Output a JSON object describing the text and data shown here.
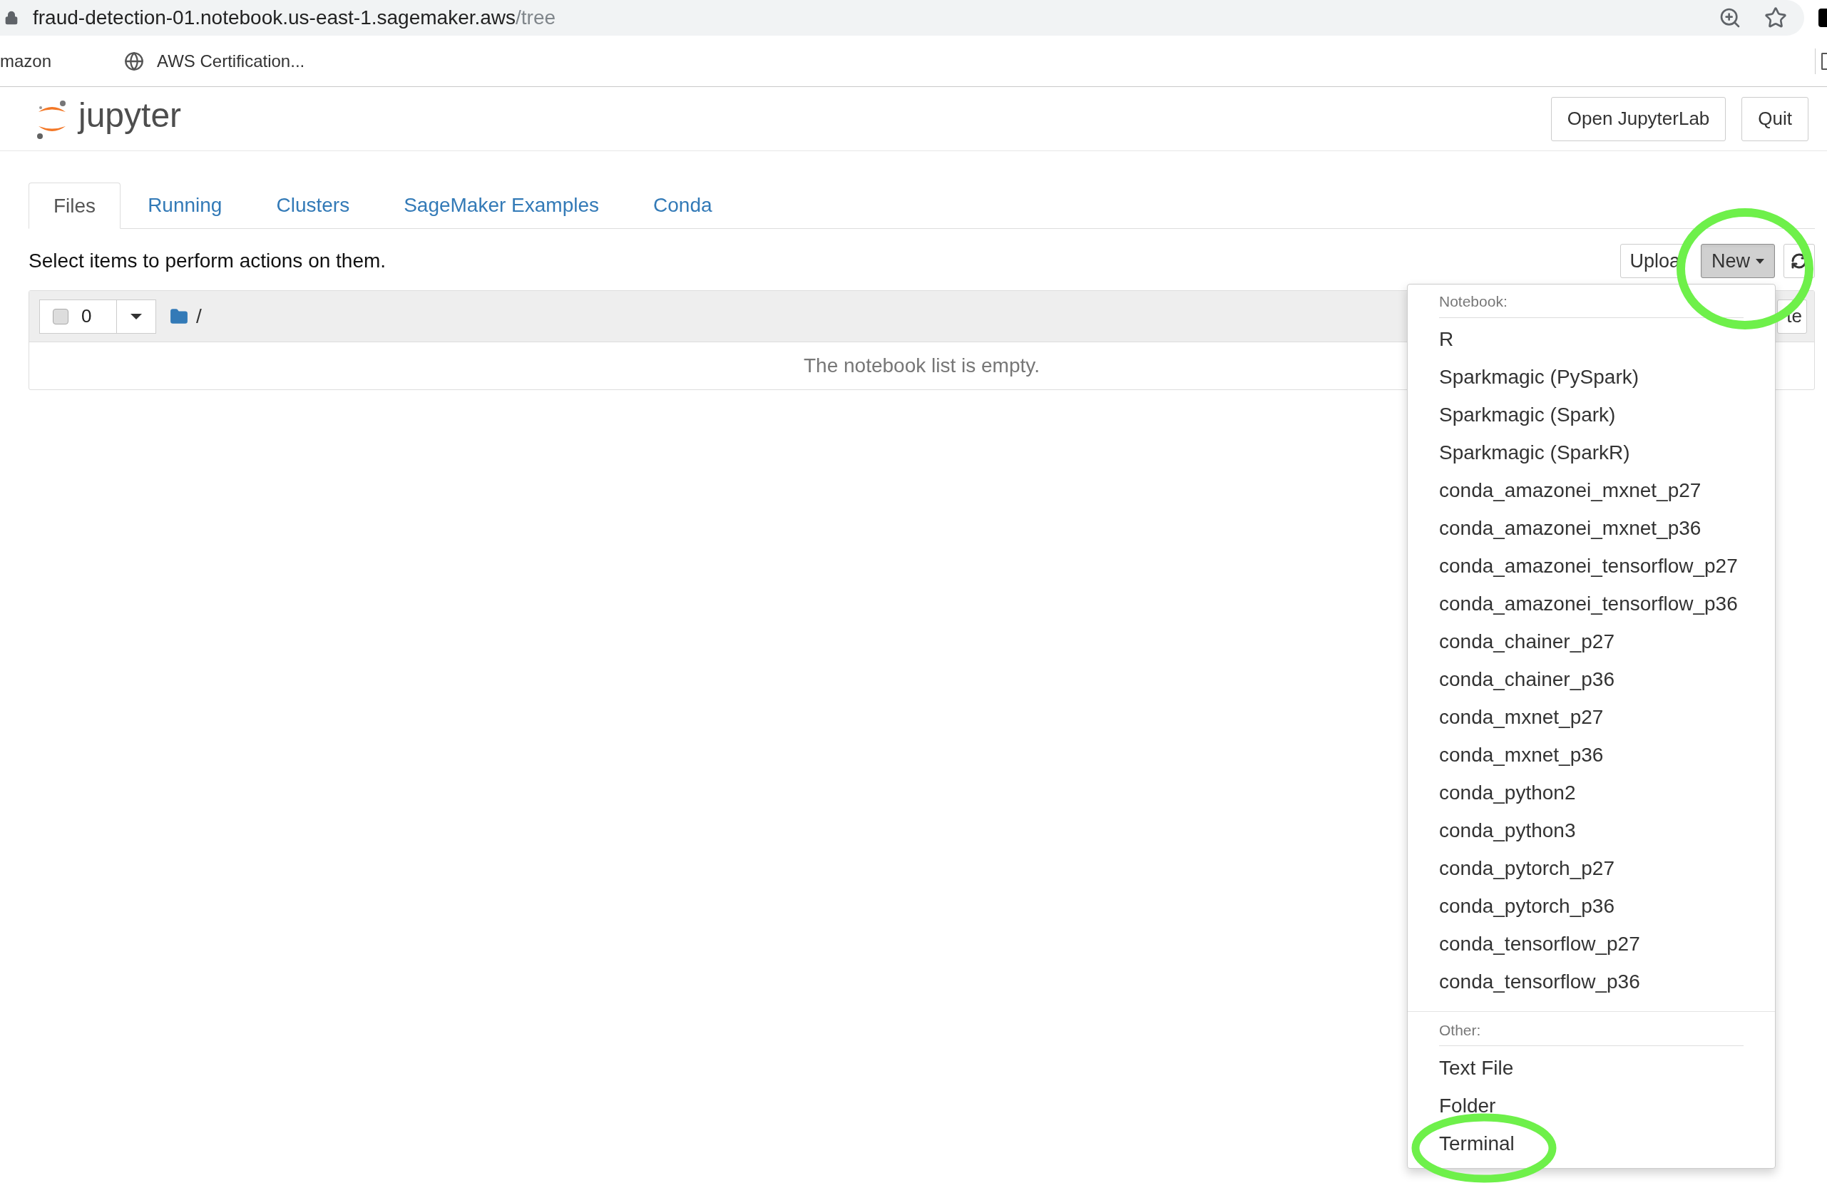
{
  "browser": {
    "url": "fraud-detection-01.notebook.us-east-1.sagemaker.aws",
    "url_path": "/tree"
  },
  "bookmarks": [
    {
      "label": "mazon",
      "kind": "plain"
    },
    {
      "label": "AWS Certification...",
      "kind": "globe"
    }
  ],
  "header": {
    "logo_text": "jupyter",
    "buttons": [
      "Open JupyterLab",
      "Quit"
    ]
  },
  "tabs": [
    {
      "label": "Files",
      "selected": true
    },
    {
      "label": "Running",
      "selected": false
    },
    {
      "label": "Clusters",
      "selected": false
    },
    {
      "label": "SageMaker Examples",
      "selected": false
    },
    {
      "label": "Conda",
      "selected": false
    }
  ],
  "instruction": "Select items to perform actions on them.",
  "toolbar_buttons": [
    {
      "label": "Uploa",
      "pressed": false
    },
    {
      "label": "New",
      "pressed": true
    }
  ],
  "file_list": {
    "checked": false,
    "selected_count": "0",
    "path": "/",
    "partial_button": "te",
    "empty_message": "The notebook list is empty."
  },
  "new_menu": [
    {
      "header": "Notebook:",
      "items": [
        "R",
        "Sparkmagic (PySpark)",
        "Sparkmagic (Spark)",
        "Sparkmagic (SparkR)",
        "conda_amazonei_mxnet_p27",
        "conda_amazonei_mxnet_p36",
        "conda_amazonei_tensorflow_p27",
        "conda_amazonei_tensorflow_p36",
        "conda_chainer_p27",
        "conda_chainer_p36",
        "conda_mxnet_p27",
        "conda_mxnet_p36",
        "conda_python2",
        "conda_python3",
        "conda_pytorch_p27",
        "conda_pytorch_p36",
        "conda_tensorflow_p27",
        "conda_tensorflow_p36"
      ]
    },
    {
      "header": "Other:",
      "items": [
        "Text File",
        "Folder",
        "Terminal"
      ]
    }
  ]
}
